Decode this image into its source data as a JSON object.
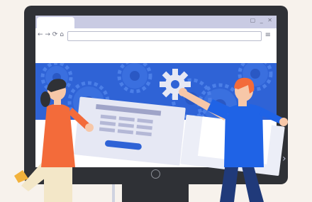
{
  "window": {
    "controls": "▢ _ ✕"
  },
  "toolbar": {
    "nav": "← → ⟳ ⌂",
    "menu": "≡"
  },
  "colors": {
    "background": "#f7f2ec",
    "monitor": "#2f3136",
    "hero_blue": "#2f63d6",
    "gear_light": "#e6e8f4",
    "shirt_orange": "#f36b3a",
    "shirt_blue": "#1f63e6"
  },
  "icons": [
    "back-icon",
    "forward-icon",
    "reload-icon",
    "home-icon",
    "menu-icon",
    "gear-icon",
    "chevron-left-icon",
    "chevron-right-icon"
  ]
}
